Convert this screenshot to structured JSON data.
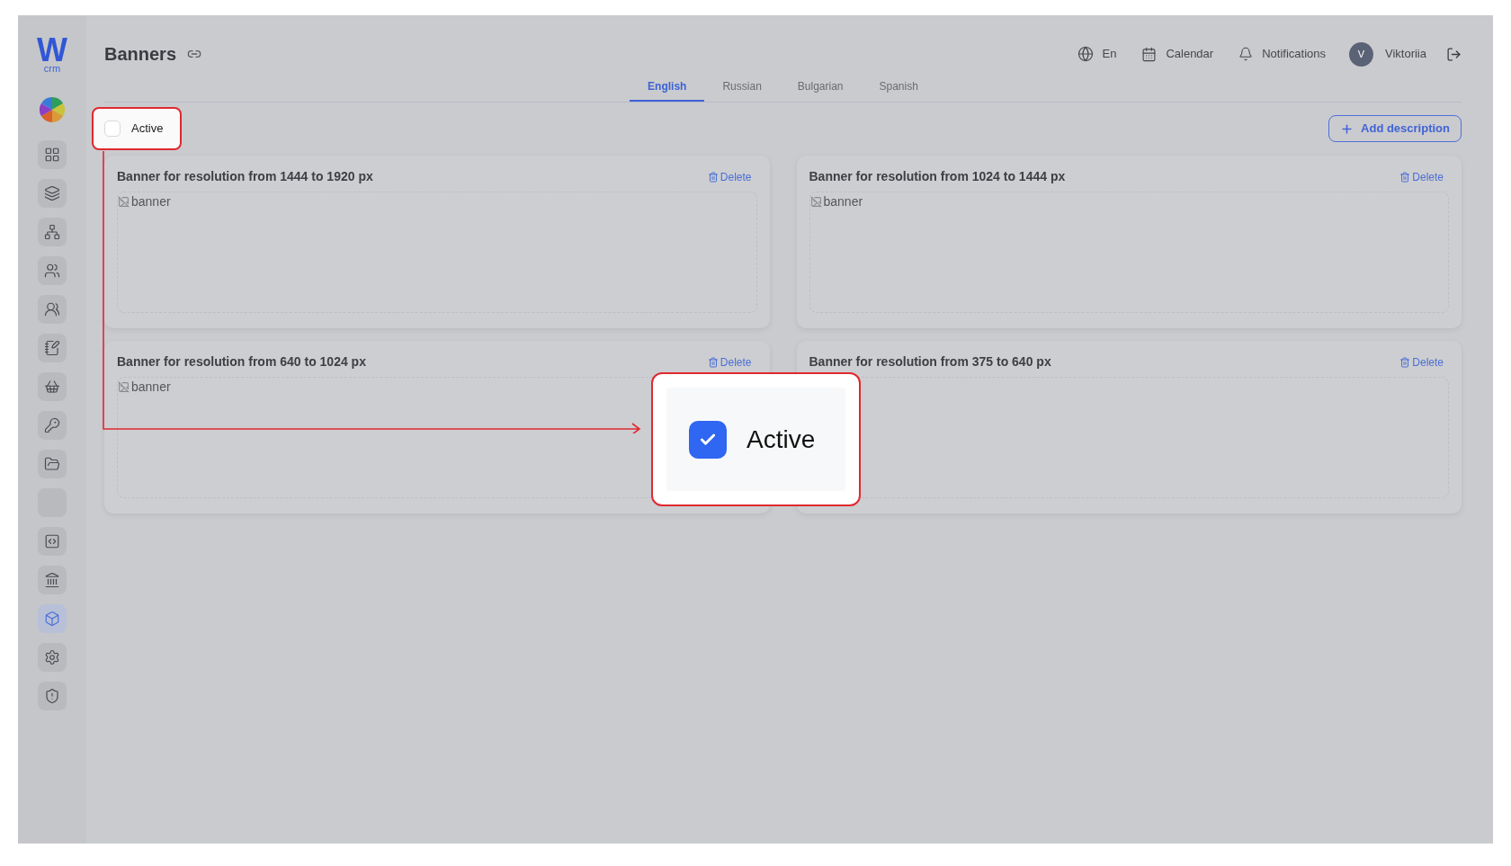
{
  "logo": {
    "letter": "W",
    "subtitle": "crm"
  },
  "sidebar": {
    "items": [
      {
        "selected": false
      },
      {
        "selected": false
      },
      {
        "selected": false
      },
      {
        "selected": false
      },
      {
        "selected": false
      },
      {
        "selected": false
      },
      {
        "selected": false
      },
      {
        "selected": false
      },
      {
        "selected": false
      },
      {
        "selected": false
      },
      {
        "selected": false
      },
      {
        "selected": false
      },
      {
        "selected": true
      },
      {
        "selected": false
      },
      {
        "selected": false
      }
    ]
  },
  "header": {
    "title": "Banners",
    "language": "En",
    "calendar": "Calendar",
    "notifications": "Notifications",
    "user": {
      "initial": "V",
      "name": "Viktoriia"
    }
  },
  "tabs": [
    {
      "label": "English",
      "selected": true
    },
    {
      "label": "Russian",
      "selected": false
    },
    {
      "label": "Bulgarian",
      "selected": false
    },
    {
      "label": "Spanish",
      "selected": false
    }
  ],
  "active_checkbox": {
    "label": "Active",
    "checked": false
  },
  "add_button": {
    "label": "Add description"
  },
  "cards": [
    {
      "title": "Banner for resolution from 1444 to 1920 px",
      "delete_label": "Delete",
      "image_alt": "banner"
    },
    {
      "title": "Banner for resolution from 1024 to 1444 px",
      "delete_label": "Delete",
      "image_alt": "banner"
    },
    {
      "title": "Banner for resolution from 640 to 1024 px",
      "delete_label": "Delete",
      "image_alt": "banner"
    },
    {
      "title": "Banner for resolution from 375 to 640 px",
      "delete_label": "Delete"
    }
  ],
  "callout": {
    "label": "Active",
    "checked": true
  }
}
